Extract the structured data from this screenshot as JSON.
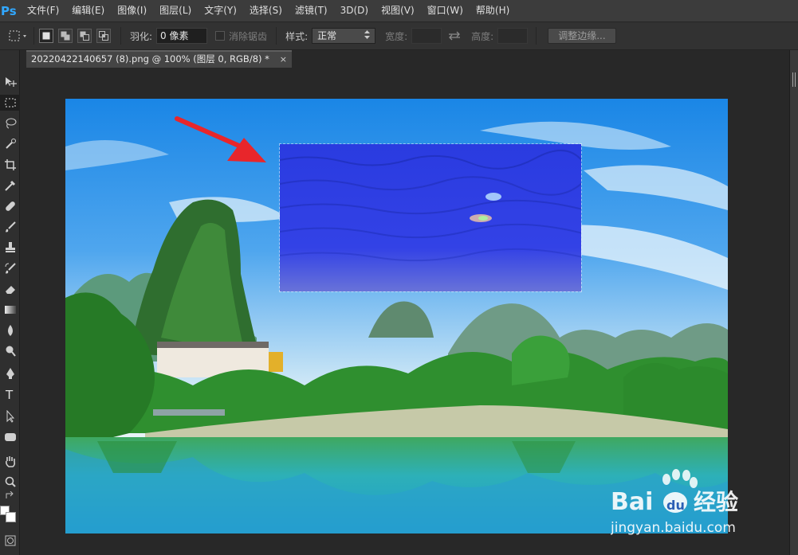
{
  "app": {
    "logo": "Ps"
  },
  "menu": [
    "文件(F)",
    "编辑(E)",
    "图像(I)",
    "图层(L)",
    "文字(Y)",
    "选择(S)",
    "滤镜(T)",
    "3D(D)",
    "视图(V)",
    "窗口(W)",
    "帮助(H)"
  ],
  "options": {
    "feather_label": "羽化:",
    "feather_value": "0 像素",
    "antialias_label": "消除锯齿",
    "style_label": "样式:",
    "style_value": "正常",
    "width_label": "宽度:",
    "height_label": "高度:",
    "refine_button": "调整边缘..."
  },
  "document": {
    "tab_title": "20220422140657 (8).png @ 100% (图层 0, RGB/8) *",
    "close_glyph": "×"
  },
  "watermark": {
    "brand": "Bai",
    "brand_suffix": "du",
    "cn": "经验",
    "url": "jingyan.baidu.com"
  },
  "colors": {
    "accent": "#31a8ff",
    "arrow": "#e8262b",
    "selection_fill": "#2b3fe0"
  }
}
